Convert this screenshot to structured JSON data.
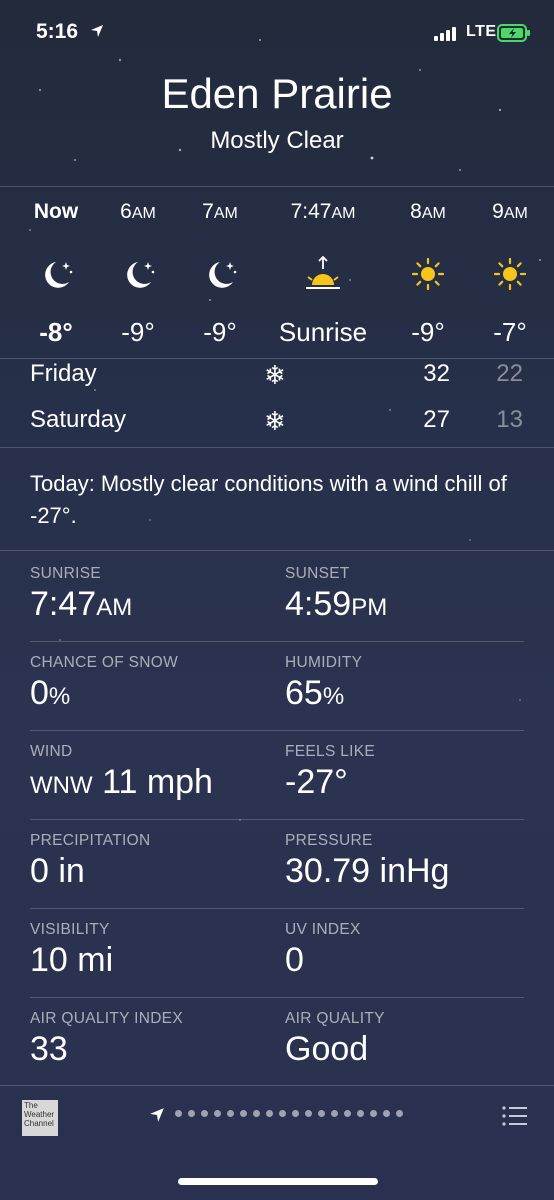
{
  "status_bar": {
    "time": "5:16",
    "carrier": "LTE"
  },
  "header": {
    "city": "Eden Prairie",
    "condition": "Mostly Clear"
  },
  "hourly": [
    {
      "label": "Now",
      "suffix": "",
      "icon": "moon-stars-icon",
      "temp": "-8°"
    },
    {
      "label": "6",
      "suffix": "AM",
      "icon": "moon-stars-icon",
      "temp": "-9°"
    },
    {
      "label": "7",
      "suffix": "AM",
      "icon": "moon-stars-icon",
      "temp": "-9°"
    },
    {
      "label": "7:47",
      "suffix": "AM",
      "icon": "sunrise-icon",
      "temp": "Sunrise"
    },
    {
      "label": "8",
      "suffix": "AM",
      "icon": "sun-icon",
      "temp": "-9°"
    },
    {
      "label": "9",
      "suffix": "AM",
      "icon": "sun-icon",
      "temp": "-7°"
    }
  ],
  "daily": [
    {
      "day": "Friday",
      "icon": "snowflake-icon",
      "high": "32",
      "low": "22"
    },
    {
      "day": "Saturday",
      "icon": "snowflake-icon",
      "high": "27",
      "low": "13"
    }
  ],
  "summary": "Today: Mostly clear conditions with a wind chill of -27°.",
  "details": {
    "sunrise": {
      "label": "SUNRISE",
      "value": "7:47",
      "unit": "AM"
    },
    "sunset": {
      "label": "SUNSET",
      "value": "4:59",
      "unit": "PM"
    },
    "chance_of_snow": {
      "label": "CHANCE OF SNOW",
      "value": "0",
      "unit": "%"
    },
    "humidity": {
      "label": "HUMIDITY",
      "value": "65",
      "unit": "%"
    },
    "wind": {
      "label": "WIND",
      "dir": "WNW",
      "value": " 11 mph"
    },
    "feels_like": {
      "label": "FEELS LIKE",
      "value": "-27°"
    },
    "precipitation": {
      "label": "PRECIPITATION",
      "value": "0 in"
    },
    "pressure": {
      "label": "PRESSURE",
      "value": "30.79 inHg"
    },
    "visibility": {
      "label": "VISIBILITY",
      "value": "10 mi"
    },
    "uv_index": {
      "label": "UV INDEX",
      "value": "0"
    },
    "aqi": {
      "label": "AIR QUALITY INDEX",
      "value": "33"
    },
    "air_quality": {
      "label": "AIR QUALITY",
      "value": "Good"
    }
  },
  "footer": {
    "brand": "The Weather Channel",
    "page_count": 18
  },
  "colors": {
    "background": "#27304a",
    "sun": "#f5c518",
    "battery": "#4cd964"
  }
}
